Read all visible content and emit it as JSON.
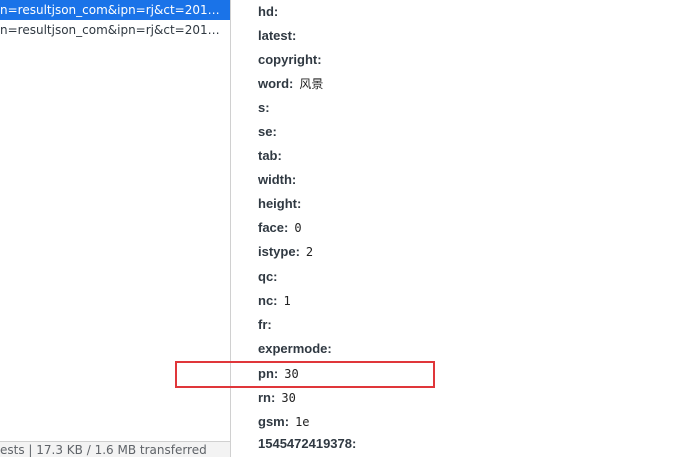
{
  "requests": [
    {
      "name": "n=resultjson_com&ipn=rj&ct=20132...",
      "selected": true
    },
    {
      "name": "n=resultjson_com&ipn=rj&ct=20132...",
      "selected": false
    }
  ],
  "status_bar": {
    "text": "ests  |  17.3 KB / 1.6 MB transferred"
  },
  "params": [
    {
      "key": "hd:",
      "value": ""
    },
    {
      "key": "latest:",
      "value": ""
    },
    {
      "key": "copyright:",
      "value": ""
    },
    {
      "key": "word:",
      "value": "风景"
    },
    {
      "key": "s:",
      "value": ""
    },
    {
      "key": "se:",
      "value": ""
    },
    {
      "key": "tab:",
      "value": ""
    },
    {
      "key": "width:",
      "value": ""
    },
    {
      "key": "height:",
      "value": ""
    },
    {
      "key": "face:",
      "value": "0"
    },
    {
      "key": "istype:",
      "value": "2"
    },
    {
      "key": "qc:",
      "value": ""
    },
    {
      "key": "nc:",
      "value": "1"
    },
    {
      "key": "fr:",
      "value": ""
    },
    {
      "key": "expermode:",
      "value": ""
    },
    {
      "key": "pn:",
      "value": "30"
    },
    {
      "key": "rn:",
      "value": "30"
    },
    {
      "key": "gsm:",
      "value": "1e"
    },
    {
      "key": "1545472419378:",
      "value": ""
    }
  ],
  "highlight": {
    "target": "pn:",
    "color": "#e0363a"
  },
  "colors": {
    "selected_row_bg": "#1a73e8",
    "highlight_border": "#e0363a"
  }
}
